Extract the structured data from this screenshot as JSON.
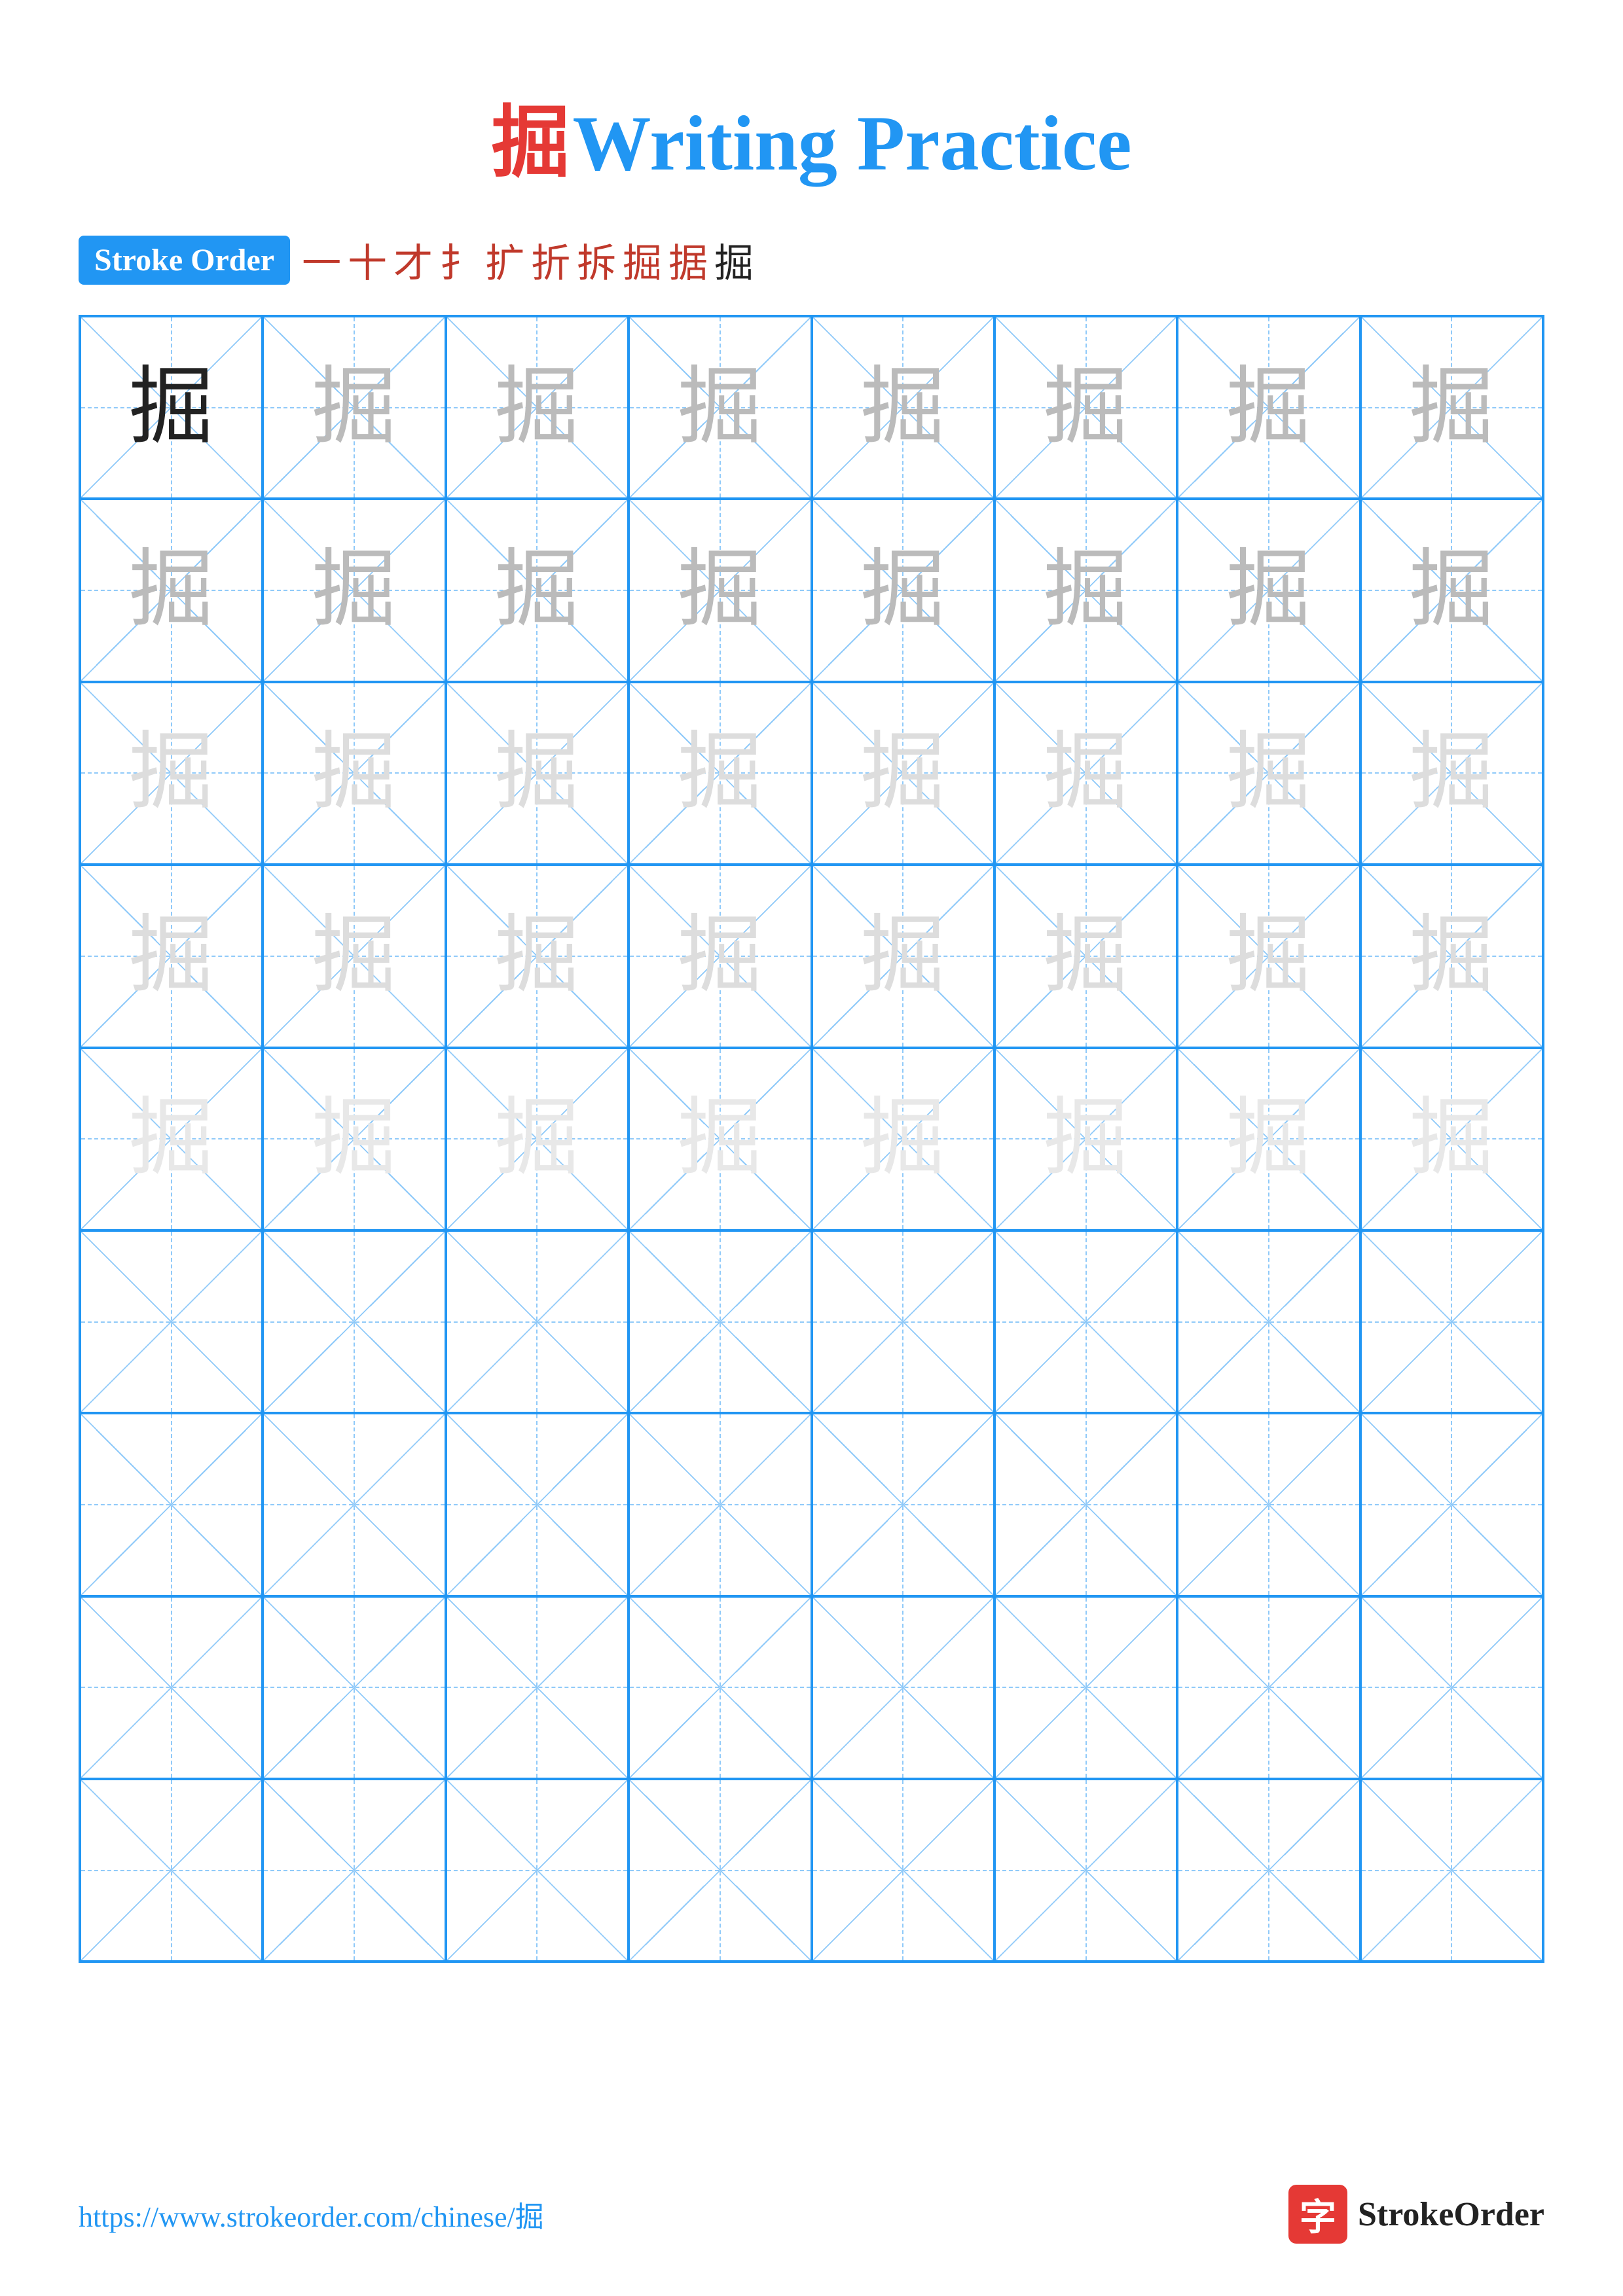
{
  "page": {
    "title_char": "掘",
    "title_text": "Writing Practice",
    "stroke_order_label": "Stroke Order",
    "stroke_sequence": [
      "一",
      "十",
      "才",
      "扌",
      "扩",
      "折",
      "拆",
      "掘",
      "据",
      "掘"
    ],
    "char": "掘",
    "url": "https://www.strokeorder.com/chinese/掘",
    "logo_char": "字",
    "logo_text": "StrokeOrder",
    "grid_rows": 10,
    "grid_cols": 8,
    "char_rows": [
      {
        "opacity": "dark",
        "count": 8
      },
      {
        "opacity": "medium",
        "count": 8
      },
      {
        "opacity": "medium",
        "count": 8
      },
      {
        "opacity": "light",
        "count": 8
      },
      {
        "opacity": "vlight",
        "count": 8
      },
      {
        "opacity": "empty",
        "count": 8
      },
      {
        "opacity": "empty",
        "count": 8
      },
      {
        "opacity": "empty",
        "count": 8
      },
      {
        "opacity": "empty",
        "count": 8
      },
      {
        "opacity": "empty",
        "count": 8
      }
    ]
  }
}
